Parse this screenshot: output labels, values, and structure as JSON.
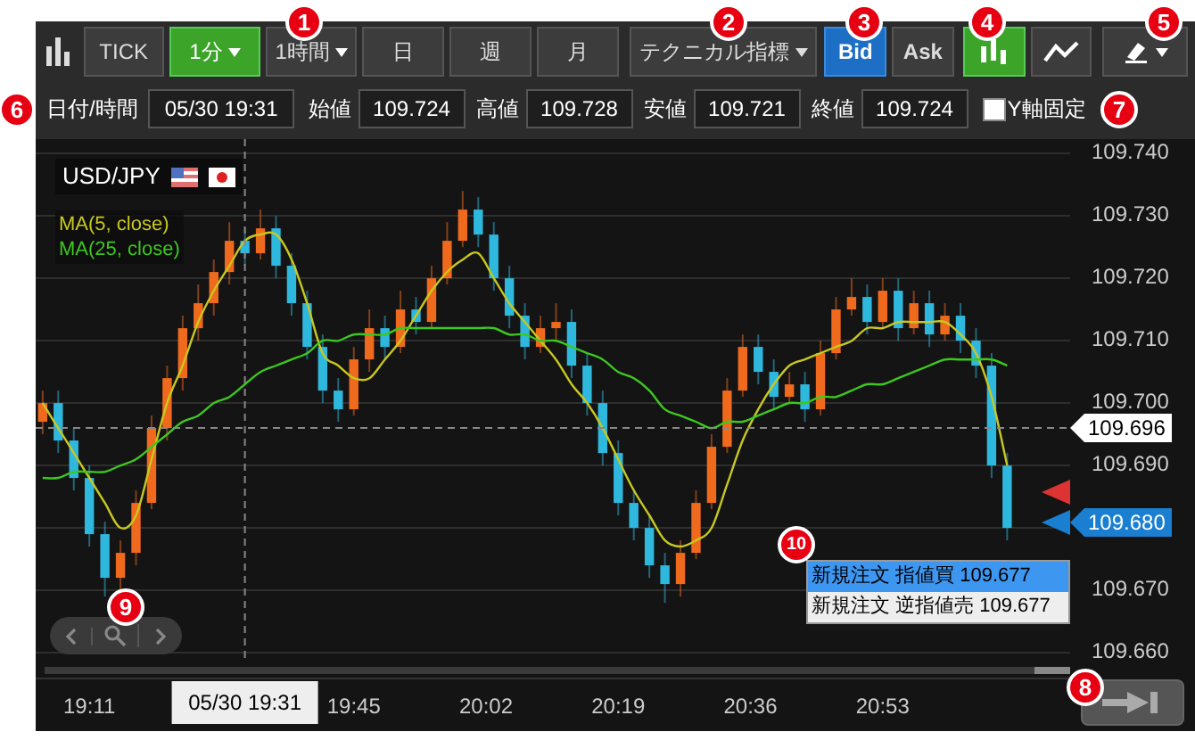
{
  "toolbar": {
    "timeframes": [
      {
        "label": "TICK",
        "selected": false,
        "dropdown": false
      },
      {
        "label": "1分",
        "selected": true,
        "dropdown": true
      },
      {
        "label": "1時間",
        "selected": false,
        "dropdown": true
      },
      {
        "label": "日",
        "selected": false,
        "dropdown": false
      },
      {
        "label": "週",
        "selected": false,
        "dropdown": false
      },
      {
        "label": "月",
        "selected": false,
        "dropdown": false
      }
    ],
    "indicator_menu": "テクニカル指標",
    "price_sides": [
      {
        "label": "Bid",
        "selected": true
      },
      {
        "label": "Ask",
        "selected": false
      }
    ],
    "chart_types": [
      {
        "kind": "candle",
        "selected": true
      },
      {
        "kind": "line",
        "selected": false
      }
    ]
  },
  "ohlc": {
    "datetime_label": "日付/時間",
    "datetime": "05/30 19:31",
    "fields": [
      {
        "label": "始値",
        "value": "109.724"
      },
      {
        "label": "高値",
        "value": "109.728"
      },
      {
        "label": "安値",
        "value": "109.721"
      },
      {
        "label": "終値",
        "value": "109.724"
      }
    ],
    "y_axis_lock": {
      "label": "Y軸固定",
      "checked": false
    }
  },
  "chart": {
    "symbol": "USD/JPY",
    "chart_data": {
      "type": "candlestick",
      "grid": true,
      "x": [
        1145,
        1147,
        1149,
        1151,
        1153,
        1155,
        1157,
        1159,
        1161,
        1163,
        1165,
        1167,
        1169,
        1171,
        1173,
        1175,
        1177,
        1179,
        1181,
        1183,
        1185,
        1187,
        1189,
        1191,
        1193,
        1195,
        1197,
        1199,
        1201,
        1203,
        1205,
        1207,
        1209,
        1211,
        1213,
        1215,
        1217,
        1219,
        1221,
        1223,
        1225,
        1227,
        1229,
        1231,
        1233,
        1235,
        1237,
        1239,
        1241,
        1243,
        1245,
        1247,
        1249,
        1251,
        1253,
        1255,
        1257,
        1259,
        1261,
        1263,
        1265,
        1267,
        1269
      ],
      "ohlc": [
        [
          109.697,
          109.702,
          109.695,
          109.7
        ],
        [
          109.7,
          109.702,
          109.692,
          109.694
        ],
        [
          109.694,
          109.696,
          109.686,
          109.688
        ],
        [
          109.688,
          109.69,
          109.677,
          109.679
        ],
        [
          109.679,
          109.681,
          109.669,
          109.672
        ],
        [
          109.672,
          109.678,
          109.67,
          109.676
        ],
        [
          109.676,
          109.686,
          109.674,
          109.684
        ],
        [
          109.684,
          109.698,
          109.683,
          109.696
        ],
        [
          109.696,
          109.706,
          109.694,
          109.704
        ],
        [
          109.704,
          109.714,
          109.702,
          109.712
        ],
        [
          109.712,
          109.719,
          109.71,
          109.716
        ],
        [
          109.716,
          109.723,
          109.714,
          109.721
        ],
        [
          109.721,
          109.729,
          109.719,
          109.726
        ],
        [
          109.726,
          109.728,
          109.722,
          109.724
        ],
        [
          109.724,
          109.731,
          109.723,
          109.728
        ],
        [
          109.728,
          109.73,
          109.72,
          109.722
        ],
        [
          109.722,
          109.724,
          109.714,
          109.716
        ],
        [
          109.716,
          109.718,
          109.707,
          109.709
        ],
        [
          109.709,
          109.711,
          109.7,
          109.702
        ],
        [
          109.702,
          109.704,
          109.697,
          109.699
        ],
        [
          109.699,
          109.709,
          109.698,
          109.707
        ],
        [
          109.707,
          109.715,
          109.705,
          109.712
        ],
        [
          109.712,
          109.714,
          109.707,
          109.709
        ],
        [
          109.709,
          109.718,
          109.708,
          109.715
        ],
        [
          109.715,
          109.717,
          109.711,
          109.713
        ],
        [
          109.713,
          109.722,
          109.712,
          109.72
        ],
        [
          109.72,
          109.729,
          109.719,
          109.726
        ],
        [
          109.726,
          109.734,
          109.725,
          109.731
        ],
        [
          109.731,
          109.733,
          109.725,
          109.727
        ],
        [
          109.727,
          109.729,
          109.718,
          109.72
        ],
        [
          109.72,
          109.722,
          109.712,
          109.714
        ],
        [
          109.714,
          109.716,
          109.707,
          109.709
        ],
        [
          109.709,
          109.714,
          109.708,
          109.712
        ],
        [
          109.712,
          109.716,
          109.71,
          109.713
        ],
        [
          109.713,
          109.715,
          109.704,
          109.706
        ],
        [
          109.706,
          109.708,
          109.698,
          109.7
        ],
        [
          109.7,
          109.702,
          109.69,
          109.692
        ],
        [
          109.692,
          109.694,
          109.682,
          109.684
        ],
        [
          109.684,
          109.686,
          109.678,
          109.68
        ],
        [
          109.68,
          109.682,
          109.672,
          109.674
        ],
        [
          109.674,
          109.676,
          109.668,
          109.671
        ],
        [
          109.671,
          109.678,
          109.669,
          109.676
        ],
        [
          109.676,
          109.686,
          109.675,
          109.684
        ],
        [
          109.684,
          109.695,
          109.683,
          109.693
        ],
        [
          109.693,
          109.704,
          109.692,
          109.702
        ],
        [
          109.702,
          109.711,
          109.701,
          109.709
        ],
        [
          109.709,
          109.711,
          109.703,
          109.705
        ],
        [
          109.705,
          109.707,
          109.699,
          109.701
        ],
        [
          109.701,
          109.705,
          109.7,
          109.703
        ],
        [
          109.703,
          109.705,
          109.697,
          109.699
        ],
        [
          109.699,
          109.71,
          109.698,
          109.708
        ],
        [
          109.708,
          109.717,
          109.707,
          109.715
        ],
        [
          109.715,
          109.72,
          109.714,
          109.717
        ],
        [
          109.717,
          109.719,
          109.711,
          109.713
        ],
        [
          109.713,
          109.72,
          109.712,
          109.718
        ],
        [
          109.718,
          109.72,
          109.71,
          109.712
        ],
        [
          109.712,
          109.718,
          109.711,
          109.716
        ],
        [
          109.716,
          109.718,
          109.709,
          109.711
        ],
        [
          109.711,
          109.716,
          109.71,
          109.714
        ],
        [
          109.714,
          109.716,
          109.708,
          109.71
        ],
        [
          109.71,
          109.712,
          109.704,
          109.706
        ],
        [
          109.706,
          109.708,
          109.688,
          109.69
        ],
        [
          109.69,
          109.692,
          109.678,
          109.68
        ]
      ],
      "xlim": [
        1144.1,
        1277.1
      ],
      "ylim": [
        109.6583,
        109.7423
      ],
      "xticks": [
        {
          "value": 1151,
          "label": "19:11"
        },
        {
          "value": 1185,
          "label": "19:45"
        },
        {
          "value": 1202,
          "label": "20:02"
        },
        {
          "value": 1219,
          "label": "20:19"
        },
        {
          "value": 1236,
          "label": "20:36"
        },
        {
          "value": 1253,
          "label": "20:53"
        }
      ],
      "yticks": [
        {
          "value": 109.74,
          "label": "109.740"
        },
        {
          "value": 109.73,
          "label": "109.730"
        },
        {
          "value": 109.72,
          "label": "109.720"
        },
        {
          "value": 109.71,
          "label": "109.710"
        },
        {
          "value": 109.7,
          "label": "109.700"
        },
        {
          "value": 109.69,
          "label": "109.690"
        },
        {
          "value": 109.67,
          "label": "109.670"
        },
        {
          "value": 109.66,
          "label": "109.660"
        }
      ],
      "ref_lines": [
        {
          "axis": "x",
          "value": 1171
        },
        {
          "axis": "y",
          "value": 109.696,
          "label": "109.696"
        }
      ],
      "series": [
        {
          "name": "MA(5, close)",
          "type": "line",
          "color": "#c8c81e",
          "values": [
            109.7,
            109.696,
            109.692,
            109.688,
            109.684,
            109.68,
            109.682,
            109.691,
            109.7,
            109.706,
            109.713,
            109.718,
            109.722,
            109.726,
            109.727,
            109.727,
            109.723,
            109.716,
            109.708,
            109.706,
            109.704,
            109.704,
            109.707,
            109.71,
            109.714,
            109.718,
            109.721,
            109.723,
            109.724,
            109.72,
            109.716,
            109.713,
            109.71,
            109.707,
            109.703,
            109.7,
            109.696,
            109.691,
            109.686,
            109.682,
            109.678,
            109.677,
            109.678,
            109.68,
            109.687,
            109.694,
            109.699,
            109.703,
            109.706,
            109.707,
            109.708,
            109.709,
            109.71,
            109.712,
            109.712,
            109.713,
            109.713,
            109.713,
            109.713,
            109.711,
            109.708,
            109.701,
            109.69
          ]
        },
        {
          "name": "MA(25, close)",
          "type": "line",
          "color": "#3cc81e",
          "values": [
            109.688,
            109.688,
            109.689,
            109.689,
            109.689,
            109.69,
            109.691,
            109.693,
            109.695,
            109.697,
            109.698,
            109.7,
            109.701,
            109.703,
            109.705,
            109.706,
            109.707,
            109.708,
            109.71,
            109.71,
            109.711,
            109.711,
            109.711,
            109.712,
            109.712,
            109.712,
            109.712,
            109.712,
            109.712,
            109.712,
            109.711,
            109.711,
            109.71,
            109.71,
            109.709,
            109.708,
            109.707,
            109.705,
            109.704,
            109.702,
            109.699,
            109.698,
            109.697,
            109.696,
            109.697,
            109.697,
            109.698,
            109.699,
            109.7,
            109.7,
            109.701,
            109.701,
            109.702,
            109.703,
            109.703,
            109.704,
            109.705,
            109.706,
            109.707,
            109.707,
            109.707,
            109.707,
            109.706
          ]
        }
      ]
    },
    "current_price": "109.680",
    "crosshair_time": "05/30 19:31",
    "order_menu": [
      {
        "label": "新規注文 指値買 109.677",
        "selected": true
      },
      {
        "label": "新規注文 逆指値売 109.677",
        "selected": false
      }
    ]
  },
  "callouts": [
    "1",
    "2",
    "3",
    "4",
    "5",
    "6",
    "7",
    "8",
    "9",
    "10"
  ]
}
